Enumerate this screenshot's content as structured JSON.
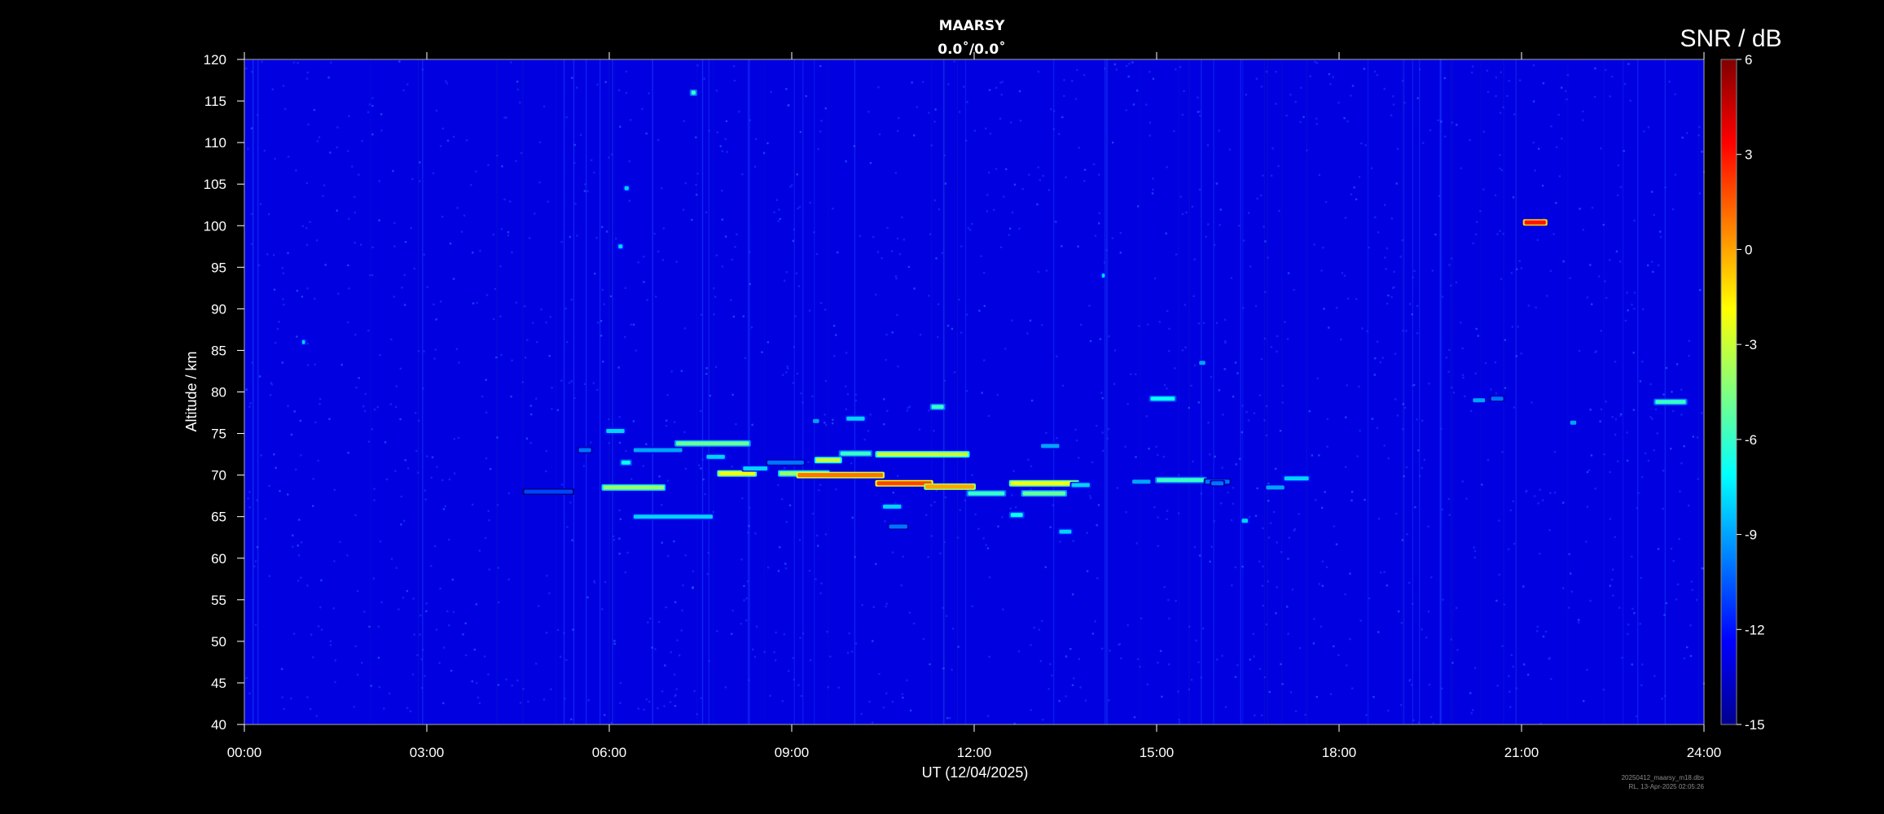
{
  "chart_data": {
    "type": "heatmap",
    "title": "MAARSY",
    "subtitle": "0.0˚/0.0˚",
    "xlabel": "UT (12/04/2025)",
    "ylabel": "Altitude / km",
    "x_tick_labels": [
      "00:00",
      "03:00",
      "06:00",
      "09:00",
      "12:00",
      "15:00",
      "18:00",
      "21:00",
      "24:00"
    ],
    "x_ticks_hours": [
      0,
      3,
      6,
      9,
      12,
      15,
      18,
      21,
      24
    ],
    "xlim_hours": [
      0,
      24
    ],
    "y_ticks": [
      40,
      45,
      50,
      55,
      60,
      65,
      70,
      75,
      80,
      85,
      90,
      95,
      100,
      105,
      110,
      115,
      120
    ],
    "ylim": [
      40,
      120
    ],
    "background_snr_db": -13,
    "colorbar": {
      "title": "SNR / dB",
      "ticks": [
        6,
        3,
        0,
        -3,
        -6,
        -9,
        -12,
        -15
      ],
      "range": [
        -15,
        6
      ],
      "colormap": "jet"
    },
    "echo_regions": [
      {
        "t_start": 5.95,
        "t_end": 6.25,
        "alt": 75.3,
        "snr_db": -8
      },
      {
        "t_start": 6.2,
        "t_end": 6.35,
        "alt": 71.5,
        "snr_db": -7
      },
      {
        "t_start": 5.9,
        "t_end": 6.9,
        "alt": 68.5,
        "snr_db": -4
      },
      {
        "t_start": 6.4,
        "t_end": 7.2,
        "alt": 73.0,
        "snr_db": -9
      },
      {
        "t_start": 7.1,
        "t_end": 8.3,
        "alt": 73.8,
        "snr_db": -5
      },
      {
        "t_start": 7.6,
        "t_end": 7.9,
        "alt": 72.2,
        "snr_db": -8
      },
      {
        "t_start": 6.4,
        "t_end": 7.7,
        "alt": 65.0,
        "snr_db": -8
      },
      {
        "t_start": 7.8,
        "t_end": 8.4,
        "alt": 70.2,
        "snr_db": -2
      },
      {
        "t_start": 8.2,
        "t_end": 8.6,
        "alt": 70.8,
        "snr_db": -8
      },
      {
        "t_start": 8.6,
        "t_end": 9.2,
        "alt": 71.5,
        "snr_db": -10
      },
      {
        "t_start": 8.8,
        "t_end": 9.6,
        "alt": 70.2,
        "snr_db": -4
      },
      {
        "t_start": 9.1,
        "t_end": 10.5,
        "alt": 70.0,
        "snr_db": 1
      },
      {
        "t_start": 9.4,
        "t_end": 9.8,
        "alt": 71.8,
        "snr_db": -3
      },
      {
        "t_start": 9.8,
        "t_end": 10.3,
        "alt": 72.6,
        "snr_db": -6
      },
      {
        "t_start": 10.4,
        "t_end": 11.9,
        "alt": 72.5,
        "snr_db": -3
      },
      {
        "t_start": 10.4,
        "t_end": 11.3,
        "alt": 69.0,
        "snr_db": 2
      },
      {
        "t_start": 11.2,
        "t_end": 12.0,
        "alt": 68.6,
        "snr_db": 0
      },
      {
        "t_start": 11.9,
        "t_end": 12.5,
        "alt": 67.8,
        "snr_db": -6
      },
      {
        "t_start": 10.5,
        "t_end": 10.8,
        "alt": 66.2,
        "snr_db": -8
      },
      {
        "t_start": 10.6,
        "t_end": 10.9,
        "alt": 63.8,
        "snr_db": -10
      },
      {
        "t_start": 12.6,
        "t_end": 13.7,
        "alt": 69.0,
        "snr_db": -2
      },
      {
        "t_start": 12.8,
        "t_end": 13.5,
        "alt": 67.8,
        "snr_db": -5
      },
      {
        "t_start": 13.6,
        "t_end": 13.9,
        "alt": 68.8,
        "snr_db": -8
      },
      {
        "t_start": 12.6,
        "t_end": 12.8,
        "alt": 65.2,
        "snr_db": -7
      },
      {
        "t_start": 13.4,
        "t_end": 13.6,
        "alt": 63.2,
        "snr_db": -8
      },
      {
        "t_start": 13.1,
        "t_end": 13.4,
        "alt": 73.5,
        "snr_db": -9
      },
      {
        "t_start": 9.9,
        "t_end": 10.2,
        "alt": 76.8,
        "snr_db": -8
      },
      {
        "t_start": 11.3,
        "t_end": 11.5,
        "alt": 78.2,
        "snr_db": -6
      },
      {
        "t_start": 9.35,
        "t_end": 9.45,
        "alt": 76.5,
        "snr_db": -9
      },
      {
        "t_start": 4.6,
        "t_end": 5.4,
        "alt": 68.0,
        "snr_db": -11
      },
      {
        "t_start": 5.5,
        "t_end": 5.7,
        "alt": 73.0,
        "snr_db": -10
      },
      {
        "t_start": 14.6,
        "t_end": 14.9,
        "alt": 69.2,
        "snr_db": -9
      },
      {
        "t_start": 15.0,
        "t_end": 15.8,
        "alt": 69.4,
        "snr_db": -6
      },
      {
        "t_start": 15.8,
        "t_end": 16.2,
        "alt": 69.2,
        "snr_db": -10
      },
      {
        "t_start": 15.9,
        "t_end": 16.1,
        "alt": 69.0,
        "snr_db": -10
      },
      {
        "t_start": 16.8,
        "t_end": 17.1,
        "alt": 68.5,
        "snr_db": -9
      },
      {
        "t_start": 17.1,
        "t_end": 17.5,
        "alt": 69.6,
        "snr_db": -8
      },
      {
        "t_start": 16.4,
        "t_end": 16.5,
        "alt": 64.5,
        "snr_db": -8
      },
      {
        "t_start": 14.9,
        "t_end": 15.3,
        "alt": 79.2,
        "snr_db": -7
      },
      {
        "t_start": 15.7,
        "t_end": 15.8,
        "alt": 83.5,
        "snr_db": -9
      },
      {
        "t_start": 20.2,
        "t_end": 20.4,
        "alt": 79.0,
        "snr_db": -9
      },
      {
        "t_start": 20.5,
        "t_end": 20.7,
        "alt": 79.2,
        "snr_db": -10
      },
      {
        "t_start": 21.8,
        "t_end": 21.9,
        "alt": 76.3,
        "snr_db": -9
      },
      {
        "t_start": 23.2,
        "t_end": 23.7,
        "alt": 78.8,
        "snr_db": -6
      },
      {
        "t_start": 21.05,
        "t_end": 21.4,
        "alt": 100.4,
        "snr_db": 3
      },
      {
        "t_start": 6.25,
        "t_end": 6.32,
        "alt": 104.5,
        "snr_db": -8
      },
      {
        "t_start": 6.15,
        "t_end": 6.22,
        "alt": 97.5,
        "snr_db": -8
      },
      {
        "t_start": 0.95,
        "t_end": 1.0,
        "alt": 86.0,
        "snr_db": -8
      },
      {
        "t_start": 14.1,
        "t_end": 14.15,
        "alt": 94.0,
        "snr_db": -8
      },
      {
        "t_start": 7.35,
        "t_end": 7.42,
        "alt": 116.0,
        "snr_db": -6
      }
    ]
  },
  "footer": {
    "line1": "20250412_maarsy_m18.dbs",
    "line2": "RL, 13-Apr-2025 02:05:26"
  }
}
